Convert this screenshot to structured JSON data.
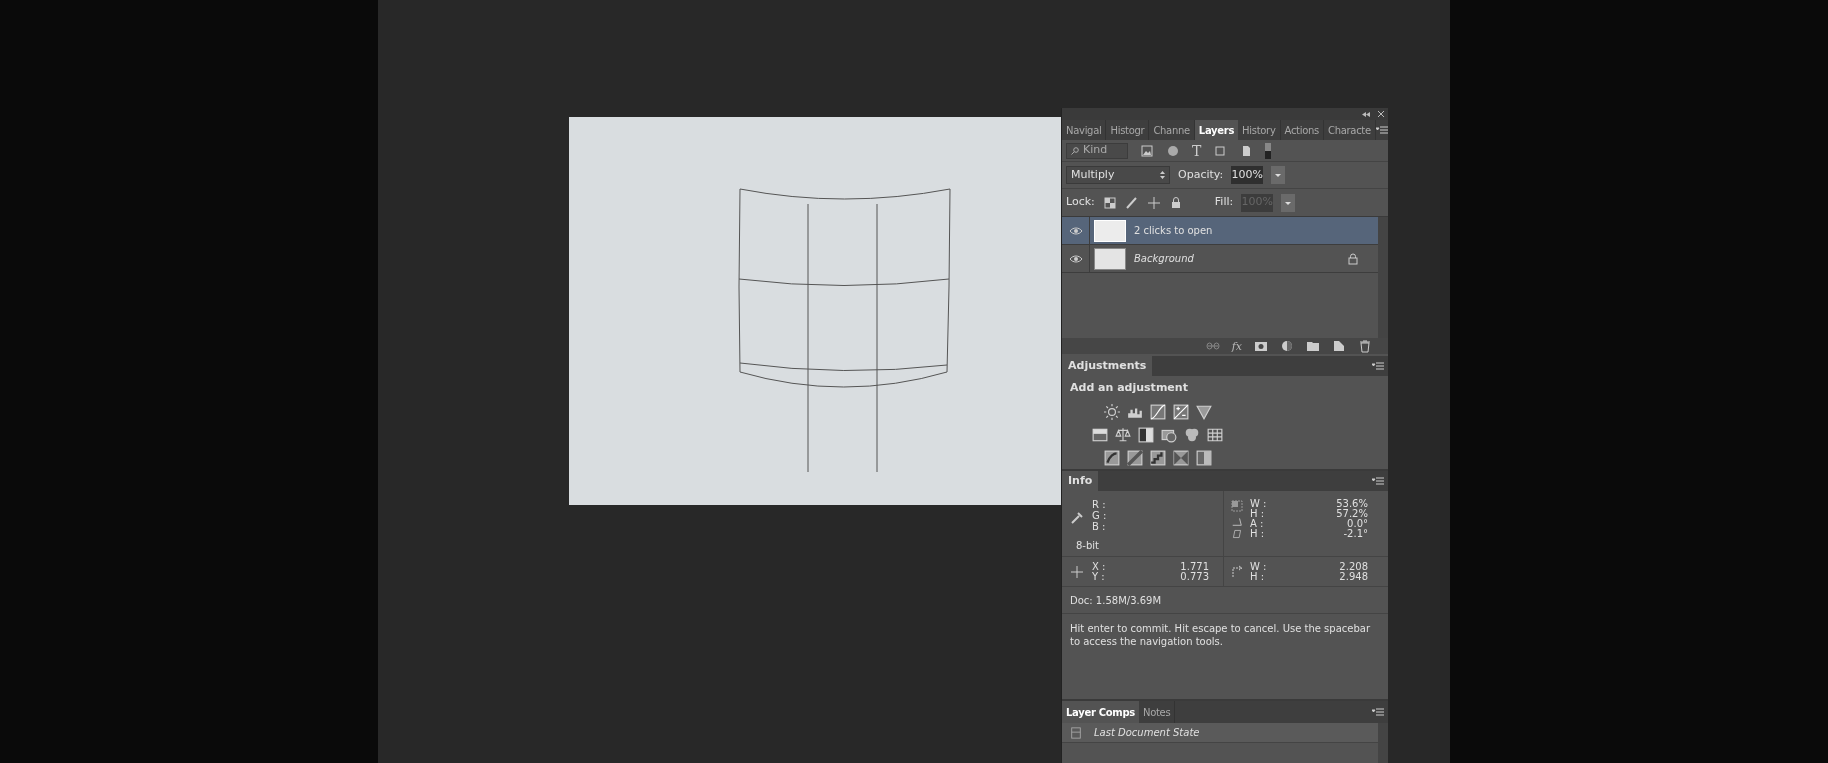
{
  "panel_tabs": [
    {
      "label": "Navigal",
      "selected": false
    },
    {
      "label": "Histogr",
      "selected": false
    },
    {
      "label": "Channe",
      "selected": false
    },
    {
      "label": "Layers",
      "selected": true
    },
    {
      "label": "History",
      "selected": false
    },
    {
      "label": "Actions",
      "selected": false
    },
    {
      "label": "Characte",
      "selected": false
    }
  ],
  "layers_panel": {
    "filter": "Kind",
    "type_filter": "T",
    "fx": "fx",
    "blend_mode": "Multiply",
    "opacity_label": "Opacity:",
    "opacity": "100%",
    "lock_label": "Lock:",
    "fill_label": "Fill:",
    "fill": "100%",
    "fill_disabled": true,
    "layers": [
      {
        "name": "2 clicks to open",
        "kind": "smart",
        "selected": true,
        "visible": true,
        "locked": false
      },
      {
        "name": "Background",
        "kind": "background",
        "selected": false,
        "visible": true,
        "locked": true
      }
    ]
  },
  "adjustments": {
    "title": "Adjustments",
    "heading": "Add an adjustment"
  },
  "info": {
    "title": "Info",
    "color_labels": [
      "R :",
      "G :",
      "B :"
    ],
    "bit_depth": "8-bit",
    "transform": [
      {
        "label": "W :",
        "value": "53.6%"
      },
      {
        "label": "H :",
        "value": "57.2%"
      },
      {
        "label": "A :",
        "value": "0.0°"
      },
      {
        "label": "H :",
        "value": "-2.1°"
      }
    ],
    "position": [
      {
        "label": "X :",
        "value": "1.771"
      },
      {
        "label": "Y :",
        "value": "0.773"
      }
    ],
    "size": [
      {
        "label": "W :",
        "value": "2.208"
      },
      {
        "label": "H :",
        "value": "2.948"
      }
    ],
    "doc": "Doc: 1.58M/3.69M",
    "message": "Hit enter to commit. Hit escape to cancel. Use the spacebar to access the navigation tools."
  },
  "bottom_tabs": [
    {
      "label": "Layer Comps",
      "selected": true
    },
    {
      "label": "Notes",
      "selected": false
    }
  ],
  "layer_comps": [
    "Last Document State"
  ]
}
